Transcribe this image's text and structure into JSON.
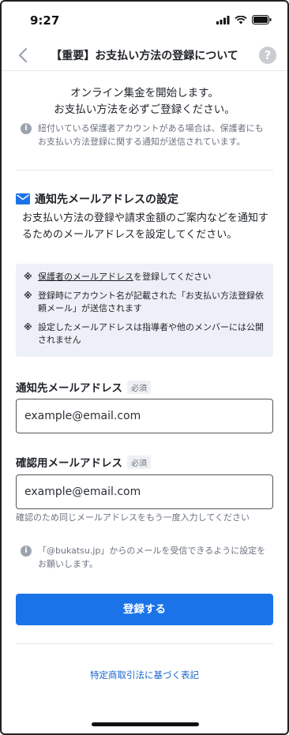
{
  "status_bar": {
    "time": "9:27"
  },
  "nav": {
    "title": "【重要】お支払い方法の登録について",
    "help_label": "?"
  },
  "intro": {
    "line1": "オンライン集金を開始します。",
    "line2": "お支払い方法を必ずご登録ください。",
    "note": "紐付いている保護者アカウントがある場合は、保護者にもお支払い方法登録に関する通知が送信されています。"
  },
  "email_section": {
    "title": "通知先メールアドレスの設定",
    "description": "お支払い方法の登録や請求金額のご案内などを通知するためのメールアドレスを設定してください。",
    "notices": [
      {
        "mark": "※",
        "link": "保護者のメールアドレス",
        "text": "を登録してください"
      },
      {
        "mark": "※",
        "link": "",
        "text": "登録時にアカウント名が記載された「お支払い方法登録依頼メール」が送信されます"
      },
      {
        "mark": "※",
        "link": "",
        "text": "設定したメールアドレスは指導者や他のメンバーには公開されません"
      }
    ]
  },
  "form": {
    "email_label": "通知先メールアドレス",
    "confirm_label": "確認用メールアドレス",
    "required_badge": "必須",
    "email_value": "example@email.com",
    "confirm_value": "example@email.com",
    "confirm_hint": "確認のため同じメールアドレスをもう一度入力してください",
    "domain_note": "「@bukatsu.jp」からのメールを受信できるように設定をお願いします。",
    "submit_label": "登録する"
  },
  "footer": {
    "link": "特定商取引法に基づく表記"
  },
  "colors": {
    "accent": "#1a73e8",
    "notice_bg": "#edf1f7"
  }
}
